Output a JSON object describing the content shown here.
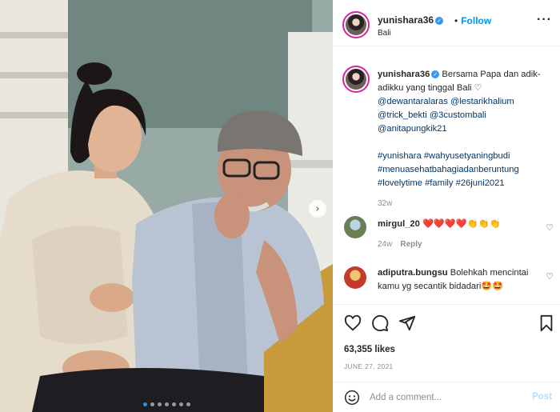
{
  "post": {
    "username": "yunishara36",
    "location": "Bali",
    "follow_label": "Follow",
    "separator": "•",
    "more_label": "···",
    "verified_mark": "✓",
    "caption": {
      "text_1": "Bersama Papa dan adik-adikku yang tinggal Bali ♡",
      "mentions": [
        "@dewantaralaras",
        "@lestarikhalium",
        "@trick_bekti",
        "@3custombali",
        "@anitapungkik21"
      ],
      "hashtags": "#yunishara #wahyusetyaningbudi #menuasehatbahagiadanberuntung #lovelytime #family #26juni2021",
      "time": "32w"
    },
    "comments": [
      {
        "username": "mirgul_20",
        "text": "❤️❤️❤️❤️👏👏👏",
        "time": "24w",
        "reply_label": "Reply"
      },
      {
        "username": "adiputra.bungsu",
        "text": "Bolehkah mencintai kamu yg secantik bidadari🤩🤩"
      }
    ],
    "likes": "63,355 likes",
    "date": "JUNE 27, 2021",
    "add_comment": {
      "placeholder": "Add a comment...",
      "post_label": "Post"
    },
    "carousel": {
      "next_label": "›",
      "count": 7,
      "active_index": 0
    }
  },
  "icons": {
    "heart": "heart-icon",
    "comment": "comment-icon",
    "share": "share-icon",
    "save": "bookmark-icon",
    "emoji": "smiley-icon",
    "more": "more-icon",
    "next": "chevron-right-icon",
    "verified": "verified-badge-icon"
  },
  "colors": {
    "accent": "#0095f6",
    "verified": "#3897f0",
    "active_dot": "#2196f3",
    "post_disabled": "#b2dffc"
  }
}
